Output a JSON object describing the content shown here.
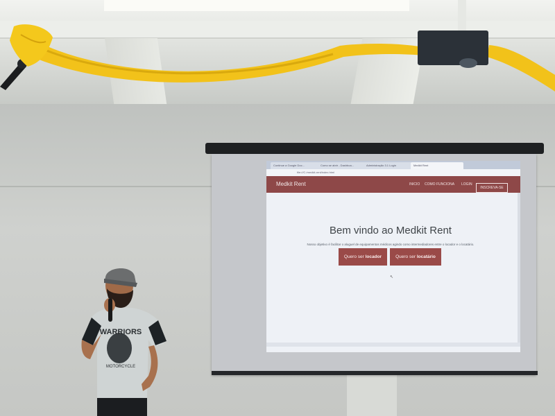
{
  "browser": {
    "tabs": [
      "Continue a Google Doc...",
      "Como se abrir - Dashboa...",
      "Administração 3.1 Login",
      "Medkit Rent"
    ],
    "url": "file:///C:/medkit-rent/index.html",
    "brand": "Medkit Rent",
    "nav": [
      "INICIO",
      "COMO FUNCIONA",
      "LOGIN"
    ],
    "signup": "INSCREVA-SE",
    "headline": "Bem vindo ao Medkit Rent",
    "tagline": "Nosso objetivo é facilitar o aluguel de equipamentos médicos agindo como intermediadores entre o locador e o locatário.",
    "cta_locador": {
      "prefix": "Quero ser",
      "strong": "locador"
    },
    "cta_locatario": {
      "prefix": "Quero ser",
      "strong": "locatário"
    }
  },
  "shirt": {
    "text": "WARRIORS",
    "subtext": "MOTORCYCLE"
  },
  "colors": {
    "drape": "#f2c21a",
    "navbar": "#8e4848",
    "button": "#9a4a48",
    "projector": "#2b3138"
  }
}
